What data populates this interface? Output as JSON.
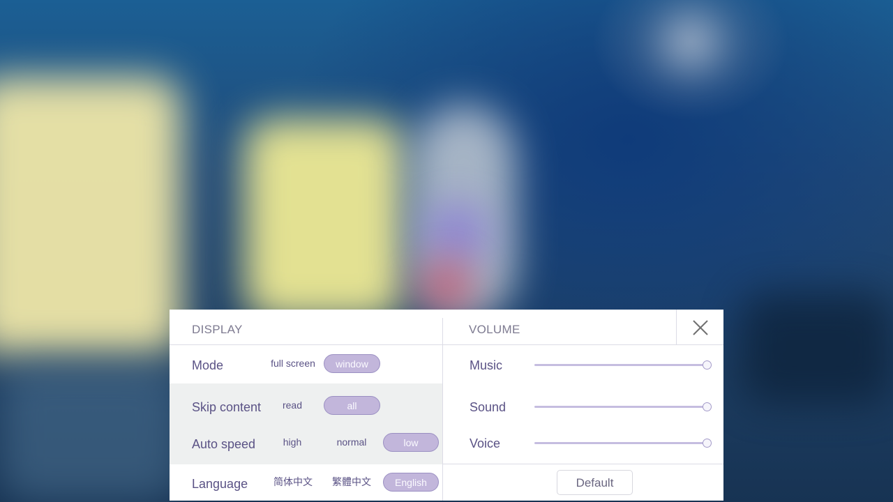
{
  "display": {
    "header": "DISPLAY",
    "mode": {
      "label": "Mode",
      "options": [
        "full screen",
        "window"
      ],
      "selected": "window"
    },
    "skip_content": {
      "label": "Skip content",
      "options": [
        "read",
        "all"
      ],
      "selected": "all"
    },
    "auto_speed": {
      "label": "Auto speed",
      "options": [
        "high",
        "normal",
        "low"
      ],
      "selected": "low"
    },
    "language": {
      "label": "Language",
      "options": [
        "简体中文",
        "繁體中文",
        "English"
      ],
      "selected": "English"
    }
  },
  "volume": {
    "header": "VOLUME",
    "music": {
      "label": "Music",
      "level": 1.0
    },
    "sound": {
      "label": "Sound",
      "level": 1.0
    },
    "voice": {
      "label": "Voice",
      "level": 1.0
    }
  },
  "buttons": {
    "close_icon": "close-icon",
    "default_label": "Default"
  },
  "colors": {
    "accent": "#c2b6db",
    "text": "#5a5285",
    "panel": "#ffffff"
  }
}
